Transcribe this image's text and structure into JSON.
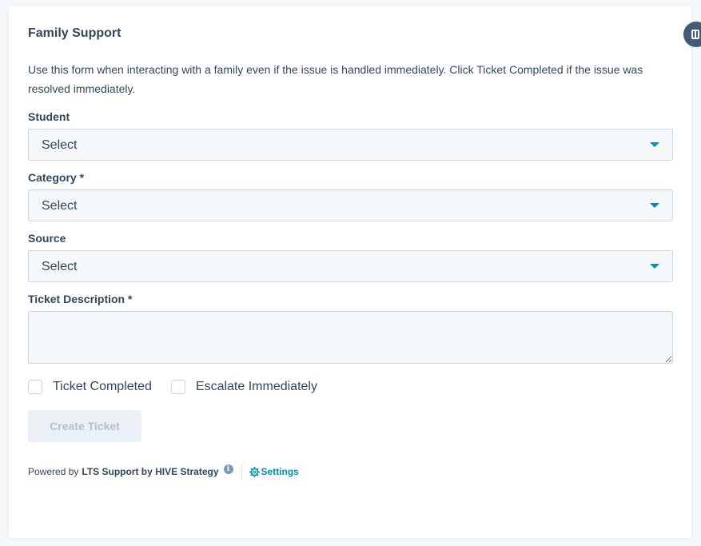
{
  "form": {
    "title": "Family Support",
    "description": "Use this form when interacting with a family even if the issue is handled immediately. Click Ticket Completed if the issue was resolved immediately.",
    "fields": {
      "student": {
        "label": "Student",
        "value": "Select"
      },
      "category": {
        "label": "Category *",
        "value": "Select"
      },
      "source": {
        "label": "Source",
        "value": "Select"
      },
      "ticket_description": {
        "label": "Ticket Description *",
        "value": ""
      }
    },
    "checkboxes": {
      "ticket_completed": {
        "label": "Ticket Completed",
        "checked": false
      },
      "escalate_immediately": {
        "label": "Escalate Immediately",
        "checked": false
      }
    },
    "submit_label": "Create Ticket"
  },
  "footer": {
    "prefix": "Powered by",
    "brand": "LTS Support by HIVE Strategy",
    "info_icon": "info-icon",
    "settings_label": "Settings",
    "settings_icon": "gear-icon"
  },
  "colors": {
    "text": "#33475b",
    "accent": "#0091ae",
    "input_bg": "#f5f8fa",
    "border": "#cbd6e2",
    "disabled_button_bg": "#eaf0f6",
    "disabled_button_text": "#b0c1d4",
    "side_toggle": "#425b76"
  },
  "side_toggle": {
    "icon": "panel-icon"
  }
}
